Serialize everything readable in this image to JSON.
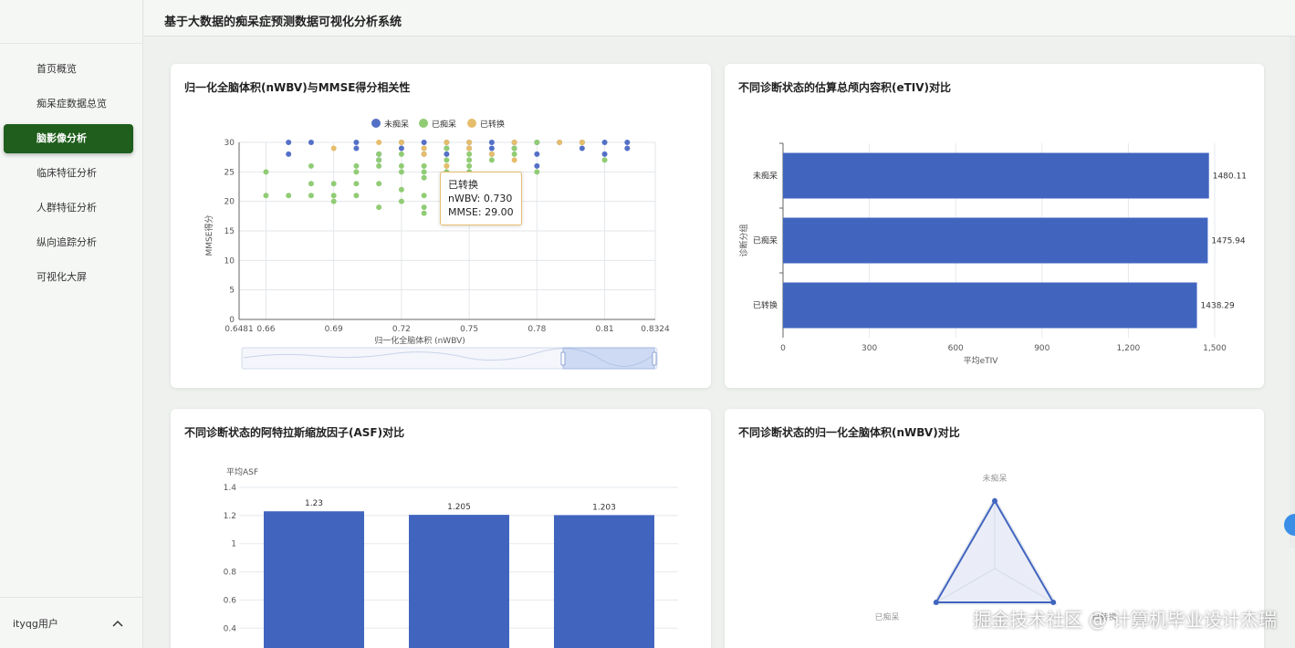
{
  "app": {
    "title": "基于大数据的痴呆症预测数据可视化分析系统"
  },
  "sidebar": {
    "items": [
      {
        "label": "首页概览",
        "active": false
      },
      {
        "label": "痴呆症数据总览",
        "active": false
      },
      {
        "label": "脑影像分析",
        "active": true
      },
      {
        "label": "临床特征分析",
        "active": false
      },
      {
        "label": "人群特征分析",
        "active": false
      },
      {
        "label": "纵向追踪分析",
        "active": false
      },
      {
        "label": "可视化大屏",
        "active": false
      }
    ],
    "user_label": "ityqg用户"
  },
  "colors": {
    "accent": "#1f5e1c",
    "blue": "#5470c6",
    "green": "#91cc75",
    "gold": "#e6bd6c",
    "bar": "#4165bf"
  },
  "cards": {
    "scatter": {
      "title": "归一化全脑体积(nWBV)与MMSE得分相关性",
      "tooltip": {
        "title": "已转换",
        "line1": "nWBV: 0.730",
        "line2": "MMSE: 29.00"
      }
    },
    "etiv": {
      "title": "不同诊断状态的估算总颅内容积(eTIV)对比"
    },
    "asf": {
      "title": "不同诊断状态的阿特拉斯缩放因子(ASF)对比"
    },
    "nwbv": {
      "title": "不同诊断状态的归一化全脑体积(nWBV)对比"
    }
  },
  "chart_data": [
    {
      "type": "scatter",
      "title": "归一化全脑体积(nWBV)与MMSE得分相关性",
      "xlabel": "归一化全脑体积 (nWBV)",
      "ylabel": "MMSE得分",
      "xlim": [
        0.6481,
        0.8324
      ],
      "ylim": [
        0,
        30
      ],
      "x_ticks": [
        "0.6481",
        "0.66",
        "0.69",
        "0.72",
        "0.75",
        "0.78",
        "0.81",
        "0.8324"
      ],
      "y_ticks": [
        "0",
        "5",
        "10",
        "15",
        "20",
        "25",
        "30"
      ],
      "legend": [
        "未痴呆",
        "已痴呆",
        "已转换"
      ],
      "legend_position": "top",
      "series": [
        {
          "name": "未痴呆",
          "color": "#5470c6",
          "points": [
            [
              0.67,
              30
            ],
            [
              0.67,
              28
            ],
            [
              0.68,
              30
            ],
            [
              0.7,
              30
            ],
            [
              0.7,
              29
            ],
            [
              0.71,
              28
            ],
            [
              0.71,
              27
            ],
            [
              0.72,
              30
            ],
            [
              0.72,
              29
            ],
            [
              0.73,
              30
            ],
            [
              0.73,
              28
            ],
            [
              0.74,
              30
            ],
            [
              0.74,
              29
            ],
            [
              0.74,
              28
            ],
            [
              0.75,
              30
            ],
            [
              0.75,
              29
            ],
            [
              0.76,
              30
            ],
            [
              0.76,
              29
            ],
            [
              0.76,
              28
            ],
            [
              0.77,
              30
            ],
            [
              0.77,
              29
            ],
            [
              0.78,
              30
            ],
            [
              0.78,
              28
            ],
            [
              0.78,
              26
            ],
            [
              0.79,
              30
            ],
            [
              0.8,
              30
            ],
            [
              0.8,
              29
            ],
            [
              0.81,
              30
            ],
            [
              0.81,
              28
            ],
            [
              0.82,
              30
            ],
            [
              0.82,
              29
            ]
          ]
        },
        {
          "name": "已痴呆",
          "color": "#91cc75",
          "points": [
            [
              0.66,
              25
            ],
            [
              0.66,
              21
            ],
            [
              0.67,
              21
            ],
            [
              0.68,
              26
            ],
            [
              0.68,
              23
            ],
            [
              0.68,
              21
            ],
            [
              0.69,
              23
            ],
            [
              0.69,
              21
            ],
            [
              0.69,
              20
            ],
            [
              0.7,
              26
            ],
            [
              0.7,
              25
            ],
            [
              0.7,
              23
            ],
            [
              0.7,
              21
            ],
            [
              0.71,
              28
            ],
            [
              0.71,
              27
            ],
            [
              0.71,
              26
            ],
            [
              0.71,
              23
            ],
            [
              0.71,
              19
            ],
            [
              0.72,
              28
            ],
            [
              0.72,
              26
            ],
            [
              0.72,
              25
            ],
            [
              0.72,
              22
            ],
            [
              0.72,
              20
            ],
            [
              0.73,
              29
            ],
            [
              0.73,
              26
            ],
            [
              0.73,
              25
            ],
            [
              0.73,
              24
            ],
            [
              0.73,
              21
            ],
            [
              0.73,
              19
            ],
            [
              0.73,
              18
            ],
            [
              0.74,
              29
            ],
            [
              0.74,
              27
            ],
            [
              0.74,
              26
            ],
            [
              0.74,
              25
            ],
            [
              0.74,
              24
            ],
            [
              0.74,
              23
            ],
            [
              0.74,
              19
            ],
            [
              0.74,
              17
            ],
            [
              0.75,
              28
            ],
            [
              0.75,
              27
            ],
            [
              0.75,
              26
            ],
            [
              0.75,
              25
            ],
            [
              0.76,
              28
            ],
            [
              0.76,
              27
            ],
            [
              0.77,
              29
            ],
            [
              0.77,
              28
            ],
            [
              0.78,
              30
            ],
            [
              0.78,
              25
            ],
            [
              0.8,
              30
            ],
            [
              0.81,
              27
            ]
          ]
        },
        {
          "name": "已转换",
          "color": "#e6bd6c",
          "points": [
            [
              0.69,
              29
            ],
            [
              0.71,
              30
            ],
            [
              0.72,
              30
            ],
            [
              0.73,
              29
            ],
            [
              0.73,
              28
            ],
            [
              0.74,
              30
            ],
            [
              0.74,
              26
            ],
            [
              0.75,
              30
            ],
            [
              0.75,
              29
            ],
            [
              0.76,
              28
            ],
            [
              0.77,
              30
            ],
            [
              0.77,
              27
            ],
            [
              0.79,
              30
            ],
            [
              0.8,
              30
            ]
          ]
        }
      ]
    },
    {
      "type": "bar",
      "orientation": "horizontal",
      "title": "不同诊断状态的估算总颅内容积(eTIV)对比",
      "categories": [
        "未痴呆",
        "已痴呆",
        "已转换"
      ],
      "values": [
        1480.11,
        1475.94,
        1438.29
      ],
      "value_labels": [
        "1480.11",
        "1475.94",
        "1438.29"
      ],
      "xlabel": "平均eTIV",
      "ylabel": "诊断分组",
      "xlim": [
        0,
        1500
      ],
      "x_ticks": [
        "0",
        "300",
        "600",
        "900",
        "1,200",
        "1,500"
      ],
      "grid": true
    },
    {
      "type": "bar",
      "title": "不同诊断状态的阿特拉斯缩放因子(ASF)对比",
      "ylabel": "平均ASF",
      "values": [
        1.23,
        1.205,
        1.203
      ],
      "value_labels": [
        "1.23",
        "1.205",
        "1.203"
      ],
      "ylim": [
        0,
        1.4
      ],
      "y_ticks": [
        "0.4",
        "0.6",
        "0.8",
        "1",
        "1.2",
        "1.4"
      ],
      "grid": true
    },
    {
      "type": "radar",
      "title": "不同诊断状态的归一化全脑体积(nWBV)对比",
      "indicators": [
        "未痴呆",
        "已痴呆",
        "已转换"
      ],
      "values": [
        0.95,
        0.95,
        0.95
      ]
    }
  ],
  "watermark": "掘金技术社区 @ 计算机毕业设计杰瑞"
}
